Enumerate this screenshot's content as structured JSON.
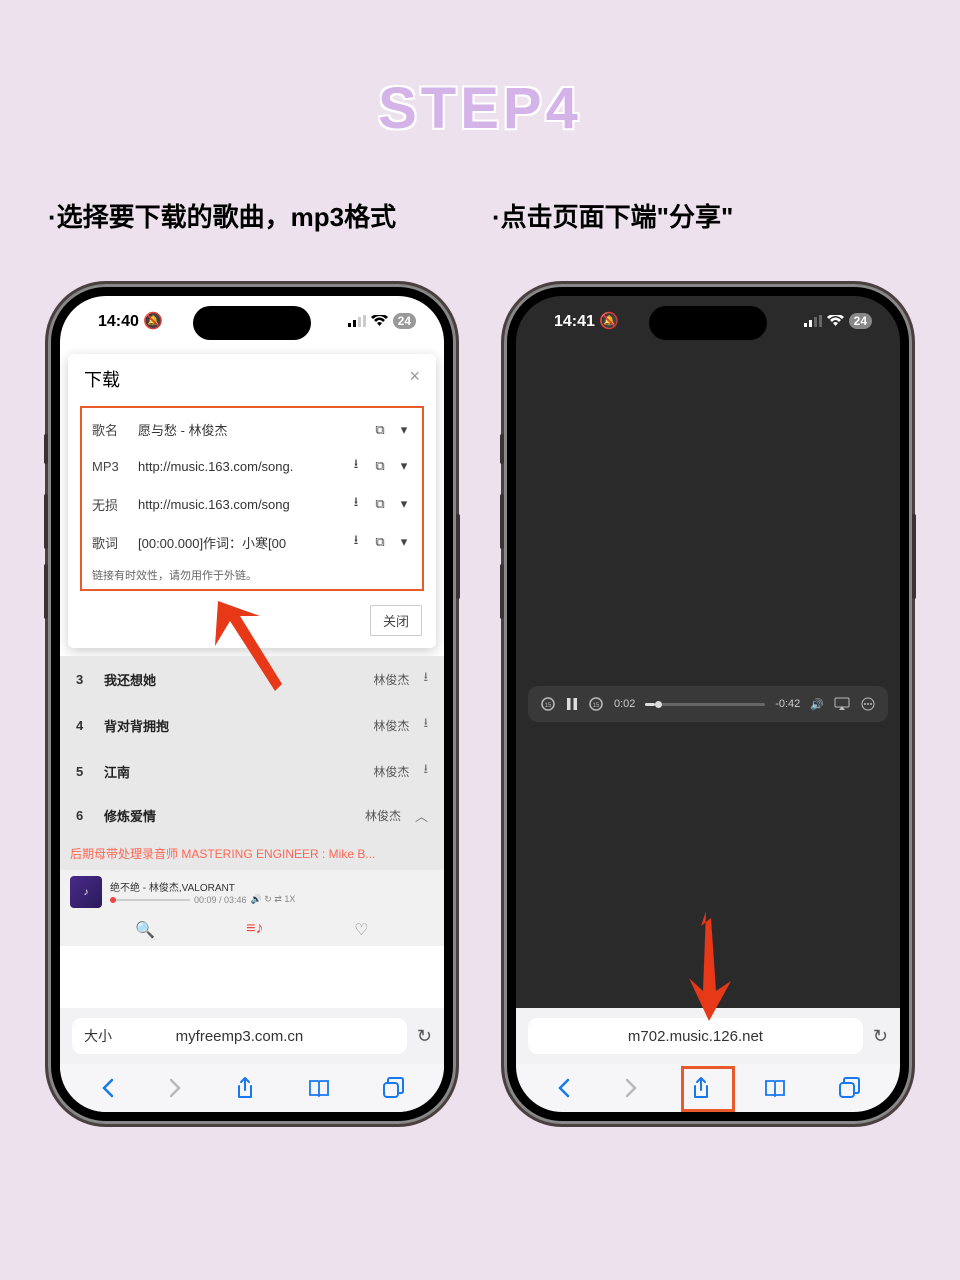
{
  "title": "STEP4",
  "caption_left": "·选择要下载的歌曲，mp3格式",
  "caption_right": "·点击页面下端\"分享\"",
  "phone1": {
    "time": "14:40",
    "battery": "24",
    "modal_title": "下载",
    "rows": [
      {
        "label": "歌名",
        "value": "愿与愁 - 林俊杰",
        "dl": false
      },
      {
        "label": "MP3",
        "value": "http://music.163.com/song.",
        "dl": true
      },
      {
        "label": "无损",
        "value": "http://music.163.com/song",
        "dl": true
      },
      {
        "label": "歌词",
        "value": "[00:00.000]作词：小寒[00",
        "dl": true
      }
    ],
    "note": "链接有时效性，请勿用作于外链。",
    "close_btn": "关闭",
    "list": [
      {
        "n": "3",
        "t": "我还想她",
        "a": "林俊杰"
      },
      {
        "n": "4",
        "t": "背对背拥抱",
        "a": "林俊杰"
      },
      {
        "n": "5",
        "t": "江南",
        "a": "林俊杰"
      },
      {
        "n": "6",
        "t": "修炼爱情",
        "a": "林俊杰"
      }
    ],
    "info_line": "后期母带处理录音师 MASTERING ENGINEER : Mike B...",
    "now_playing": "绝不绝 - 林俊杰,VALORANT",
    "now_time": "00:09 / 03:46",
    "addr_left": "大小",
    "url": "myfreemp3.com.cn"
  },
  "phone2": {
    "time": "14:41",
    "battery": "24",
    "media_time_cur": "0:02",
    "media_time_rem": "-0:42",
    "url": "m702.music.126.net"
  }
}
